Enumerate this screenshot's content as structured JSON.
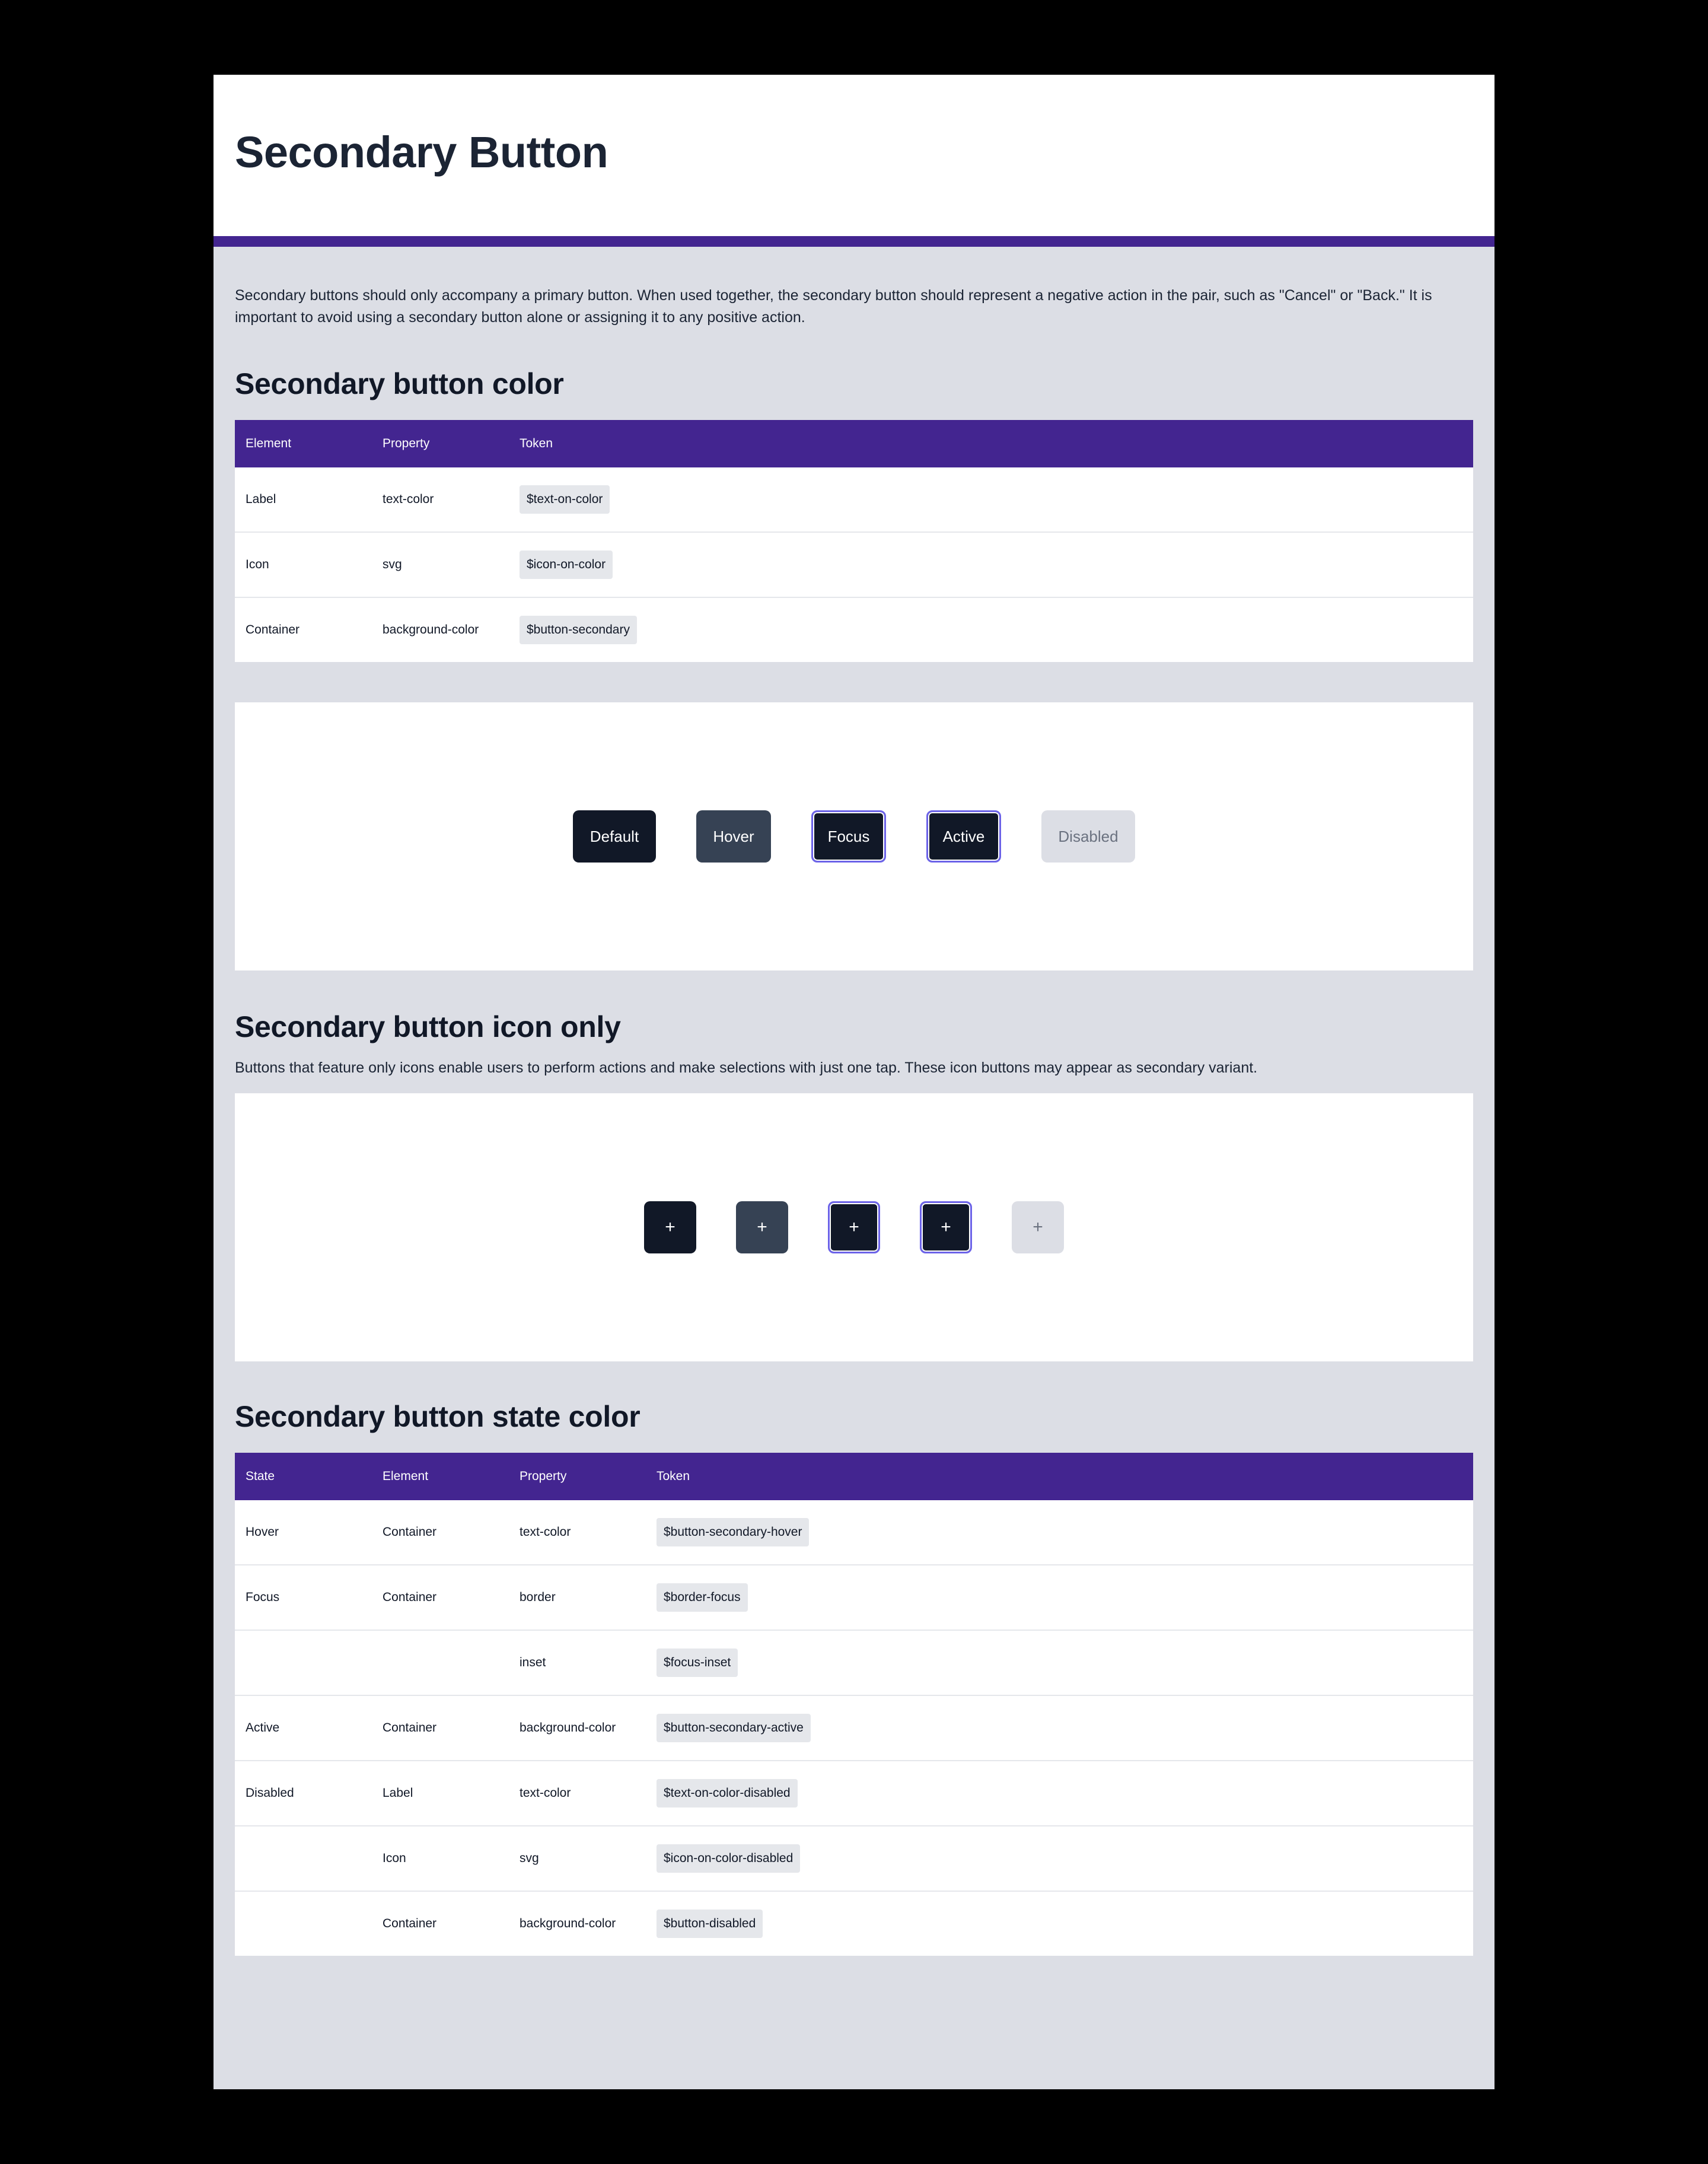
{
  "page_title": "Secondary Button",
  "intro": "Secondary buttons should only accompany a primary button. When used together, the secondary button should represent a negative action in the pair, such as \"Cancel\" or \"Back.\" It is important to avoid using a secondary button alone or assigning it to any positive action.",
  "color_section": {
    "title": "Secondary button color",
    "headers": [
      "Element",
      "Property",
      "Token"
    ],
    "rows": [
      {
        "element": "Label",
        "property": "text-color",
        "token": "$text-on-color"
      },
      {
        "element": "Icon",
        "property": "svg",
        "token": "$icon-on-color"
      },
      {
        "element": "Container",
        "property": "background-color",
        "token": "$button-secondary"
      }
    ]
  },
  "button_demo": {
    "default": "Default",
    "hover": "Hover",
    "focus": "Focus",
    "active": "Active",
    "disabled": "Disabled"
  },
  "icon_section": {
    "title": "Secondary button icon only",
    "description": "Buttons that feature only icons enable users to perform actions and make selections with just one tap. These icon buttons may appear as secondary variant.",
    "icon_glyph": "+"
  },
  "state_section": {
    "title": "Secondary button state color",
    "headers": [
      "State",
      "Element",
      "Property",
      "Token"
    ],
    "rows": [
      {
        "state": "Hover",
        "element": "Container",
        "property": "text-color",
        "token": "$button-secondary-hover"
      },
      {
        "state": "Focus",
        "element": "Container",
        "property": "border",
        "token": "$border-focus"
      },
      {
        "state": "",
        "element": "",
        "property": "inset",
        "token": "$focus-inset"
      },
      {
        "state": "Active",
        "element": "Container",
        "property": "background-color",
        "token": "$button-secondary-active"
      },
      {
        "state": "Disabled",
        "element": "Label",
        "property": "text-color",
        "token": "$text-on-color-disabled"
      },
      {
        "state": "",
        "element": "Icon",
        "property": "svg",
        "token": "$icon-on-color-disabled"
      },
      {
        "state": "",
        "element": "Container",
        "property": "background-color",
        "token": "$button-disabled"
      }
    ]
  },
  "colors": {
    "accent": "#432590",
    "button_default": "#111827",
    "button_hover": "#364254",
    "focus_border": "#6c63e8",
    "button_disabled": "#dcdee5",
    "page_bg": "#dcdee5"
  }
}
